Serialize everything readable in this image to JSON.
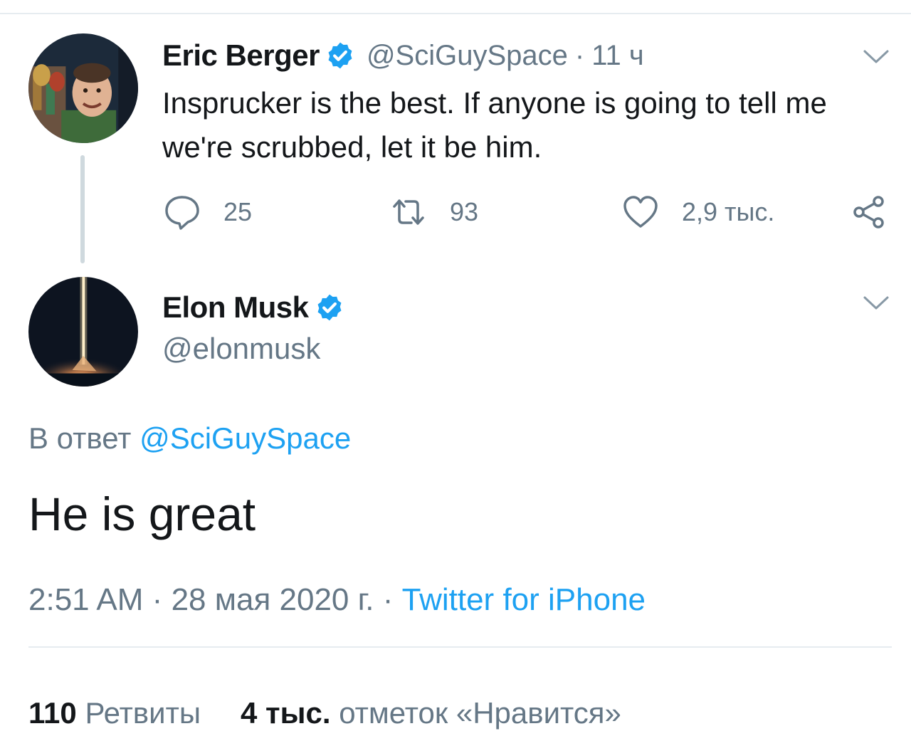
{
  "parent_tweet": {
    "author_name": "Eric Berger",
    "handle": "@SciGuySpace",
    "separator": "·",
    "time": "11 ч",
    "text": "Insprucker is the best. If anyone is going to tell me we're scrubbed, let it be him.",
    "replies": "25",
    "retweets": "93",
    "likes": "2,9 тыс."
  },
  "main_tweet": {
    "author_name": "Elon Musk",
    "handle": "@elonmusk",
    "reply_prefix": "В ответ",
    "reply_to": "@SciGuySpace",
    "text": "He is great",
    "time": "2:51 AM",
    "date": "28 мая 2020 г.",
    "separator": "·",
    "source": "Twitter for iPhone",
    "retweets_count": "110",
    "retweets_label": "Ретвиты",
    "likes_count": "4 тыс.",
    "likes_label": "отметок «Нравится»"
  },
  "colors": {
    "accent": "#1da1f2",
    "secondary_text": "#657786",
    "primary_text": "#14171a",
    "divider": "#e6ecf0"
  },
  "icons": {
    "verified": "verified-badge-icon",
    "chevron": "chevron-down-icon",
    "reply": "reply-icon",
    "retweet": "retweet-icon",
    "like": "heart-icon",
    "share": "share-icon"
  }
}
